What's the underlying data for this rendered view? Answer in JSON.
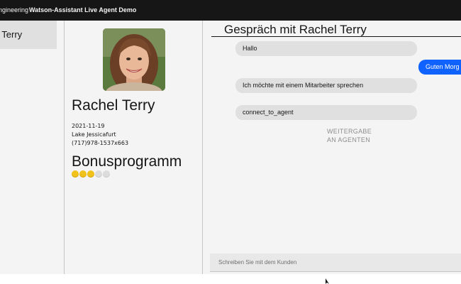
{
  "header": {
    "prefix": "Engineering",
    "title": "Watson-Assistant Live Agent Demo"
  },
  "sidebar": {
    "items": [
      {
        "label": "Rachel Terry",
        "visible_label": "l Terry"
      }
    ]
  },
  "customer": {
    "name": "Rachel Terry",
    "date": "2021-11-19",
    "location": "Lake Jessicafurt",
    "phone": "(717)978-1537x663",
    "bonus_title": "Bonusprogramm",
    "bonus_level": 3,
    "bonus_max": 5
  },
  "chat": {
    "title": "Gespräch mit Rachel Terry",
    "messages": [
      {
        "from": "user",
        "text": "Hallo"
      },
      {
        "from": "agent",
        "text": "Guten Morg"
      },
      {
        "from": "user",
        "text": "Ich möchte mit einem Mitarbeiter sprechen"
      },
      {
        "from": "user",
        "text": "connect_to_agent"
      }
    ],
    "handoff_line1": "WEITERGABE",
    "handoff_line2": "AN AGENTEN",
    "input_placeholder": "Schreiben Sie mit dem Kunden",
    "input_value": ""
  },
  "colors": {
    "topbar": "#161616",
    "user_bubble": "#e0e0e0",
    "agent_bubble": "#0f62fe",
    "coin_active": "#f1c21b",
    "coin_inactive": "#dcdcdc"
  }
}
